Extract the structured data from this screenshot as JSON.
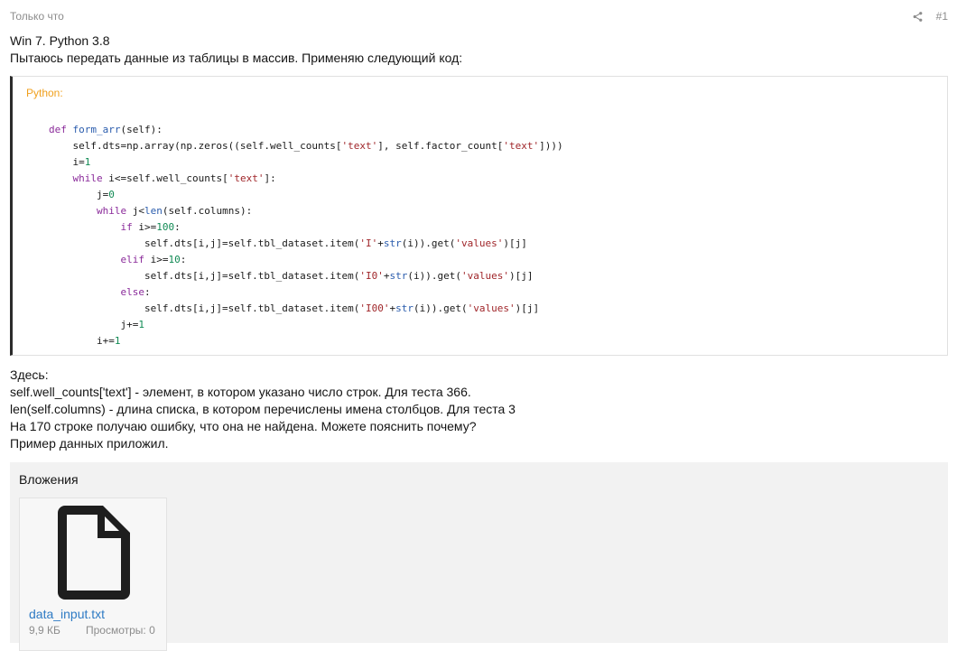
{
  "post": {
    "time": "Только что",
    "number": "#1",
    "share_icon": "share-icon"
  },
  "intro": [
    "Win 7. Python 3.8",
    "Пытаюсь передать данные из таблицы в массив. Применяю следующий код:"
  ],
  "code": {
    "language": "Python:",
    "lines": [
      "def form_arr(self):",
      "    self.dts=np.array(np.zeros((self.well_counts['text'], self.factor_count['text'])))",
      "    i=1",
      "    while i<=self.well_counts['text']:",
      "        j=0",
      "        while j<len(self.columns):",
      "            if i>=100:",
      "                self.dts[i,j]=self.tbl_dataset.item('I'+str(i)).get('values')[j]",
      "            elif i>=10:",
      "                self.dts[i,j]=self.tbl_dataset.item('I0'+str(i)).get('values')[j]",
      "            else:",
      "                self.dts[i,j]=self.tbl_dataset.item('I00'+str(i)).get('values')[j]",
      "            j+=1",
      "        i+=1"
    ]
  },
  "explanation": [
    "Здесь:",
    "self.well_counts['text'] - элемент, в котором указано число строк. Для теста 366.",
    "len(self.columns) - длина списка, в котором перечислены имена столбцов. Для теста 3",
    "На 170 строке получаю ошибку, что она не найдена. Можете пояснить почему?",
    "Пример данных приложил."
  ],
  "attachments": {
    "title": "Вложения",
    "items": [
      {
        "icon": "file-icon",
        "name": "data_input.txt",
        "size": "9,9 КБ",
        "views": "Просмотры: 0"
      }
    ]
  }
}
